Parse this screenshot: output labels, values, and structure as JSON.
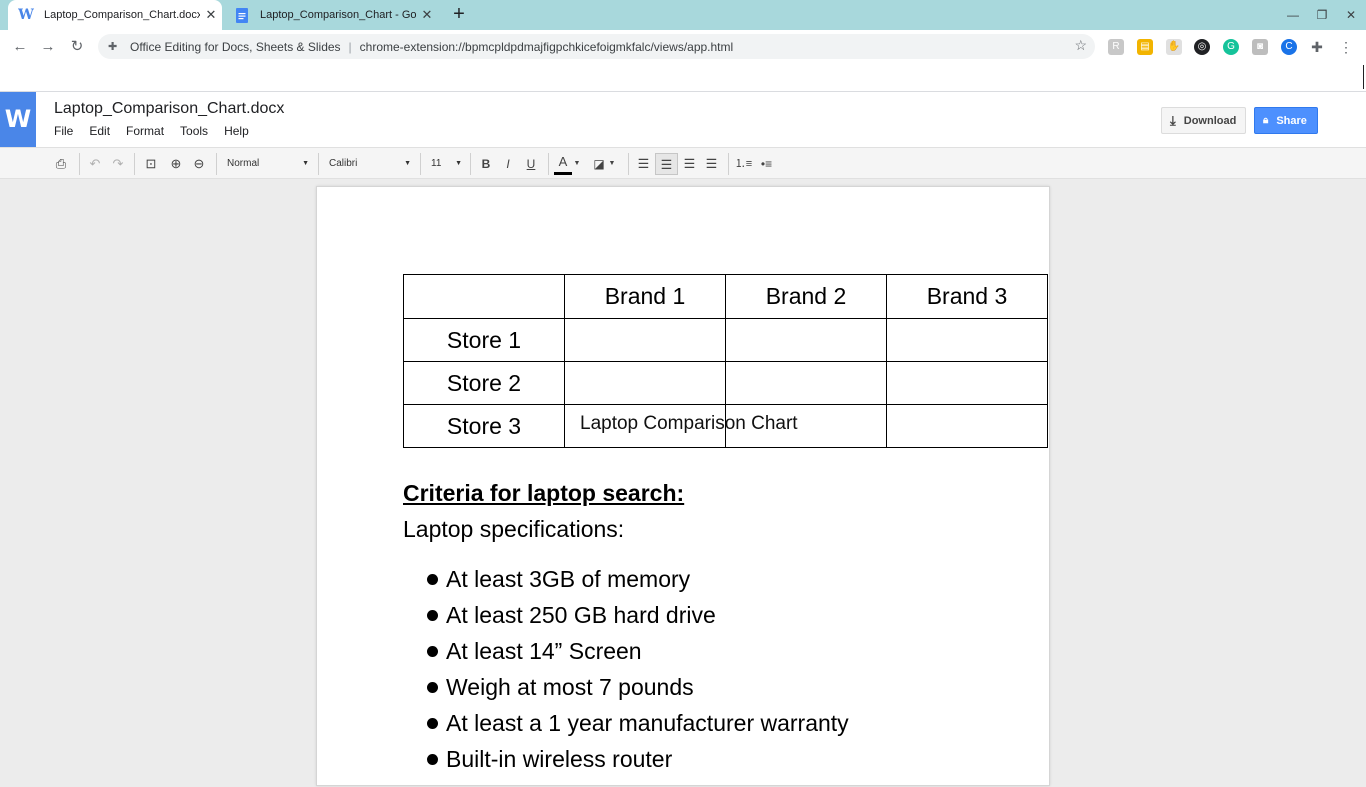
{
  "browser": {
    "tabs": [
      {
        "title": "Laptop_Comparison_Chart.docx",
        "icon": "word-icon",
        "active": true
      },
      {
        "title": "Laptop_Comparison_Chart - Goo",
        "icon": "google-docs-icon",
        "active": false
      }
    ],
    "address": {
      "site_label": "Office Editing for Docs, Sheets & Slides",
      "url": "chrome-extension://bpmcpldpdmajfigpchkicefoigmkfalc/views/app.html"
    }
  },
  "app": {
    "logo_letter": "W",
    "doc_title": "Laptop_Comparison_Chart.docx",
    "menu": [
      "File",
      "Edit",
      "Format",
      "Tools",
      "Help"
    ],
    "download_label": "Download",
    "share_label": "Share",
    "style_value": "Normal",
    "font_value": "Calibri",
    "size_value": "11"
  },
  "document": {
    "table": {
      "header": [
        "",
        "Brand 1",
        "Brand 2",
        "Brand 3"
      ],
      "rows": [
        [
          "Store 1",
          "",
          "",
          ""
        ],
        [
          "Store 2",
          "",
          "",
          ""
        ],
        [
          "Store 3",
          "",
          "",
          ""
        ]
      ]
    },
    "overlay_text": "Laptop Comparison Chart",
    "criteria_heading": "Criteria for laptop search:",
    "specs_heading": "Laptop specifications:",
    "specs": [
      "At least 3GB of memory",
      "At least 250 GB hard drive",
      "At least 14” Screen",
      "Weigh at most 7 pounds",
      "At least a 1 year manufacturer warranty",
      "Built-in wireless router"
    ]
  }
}
